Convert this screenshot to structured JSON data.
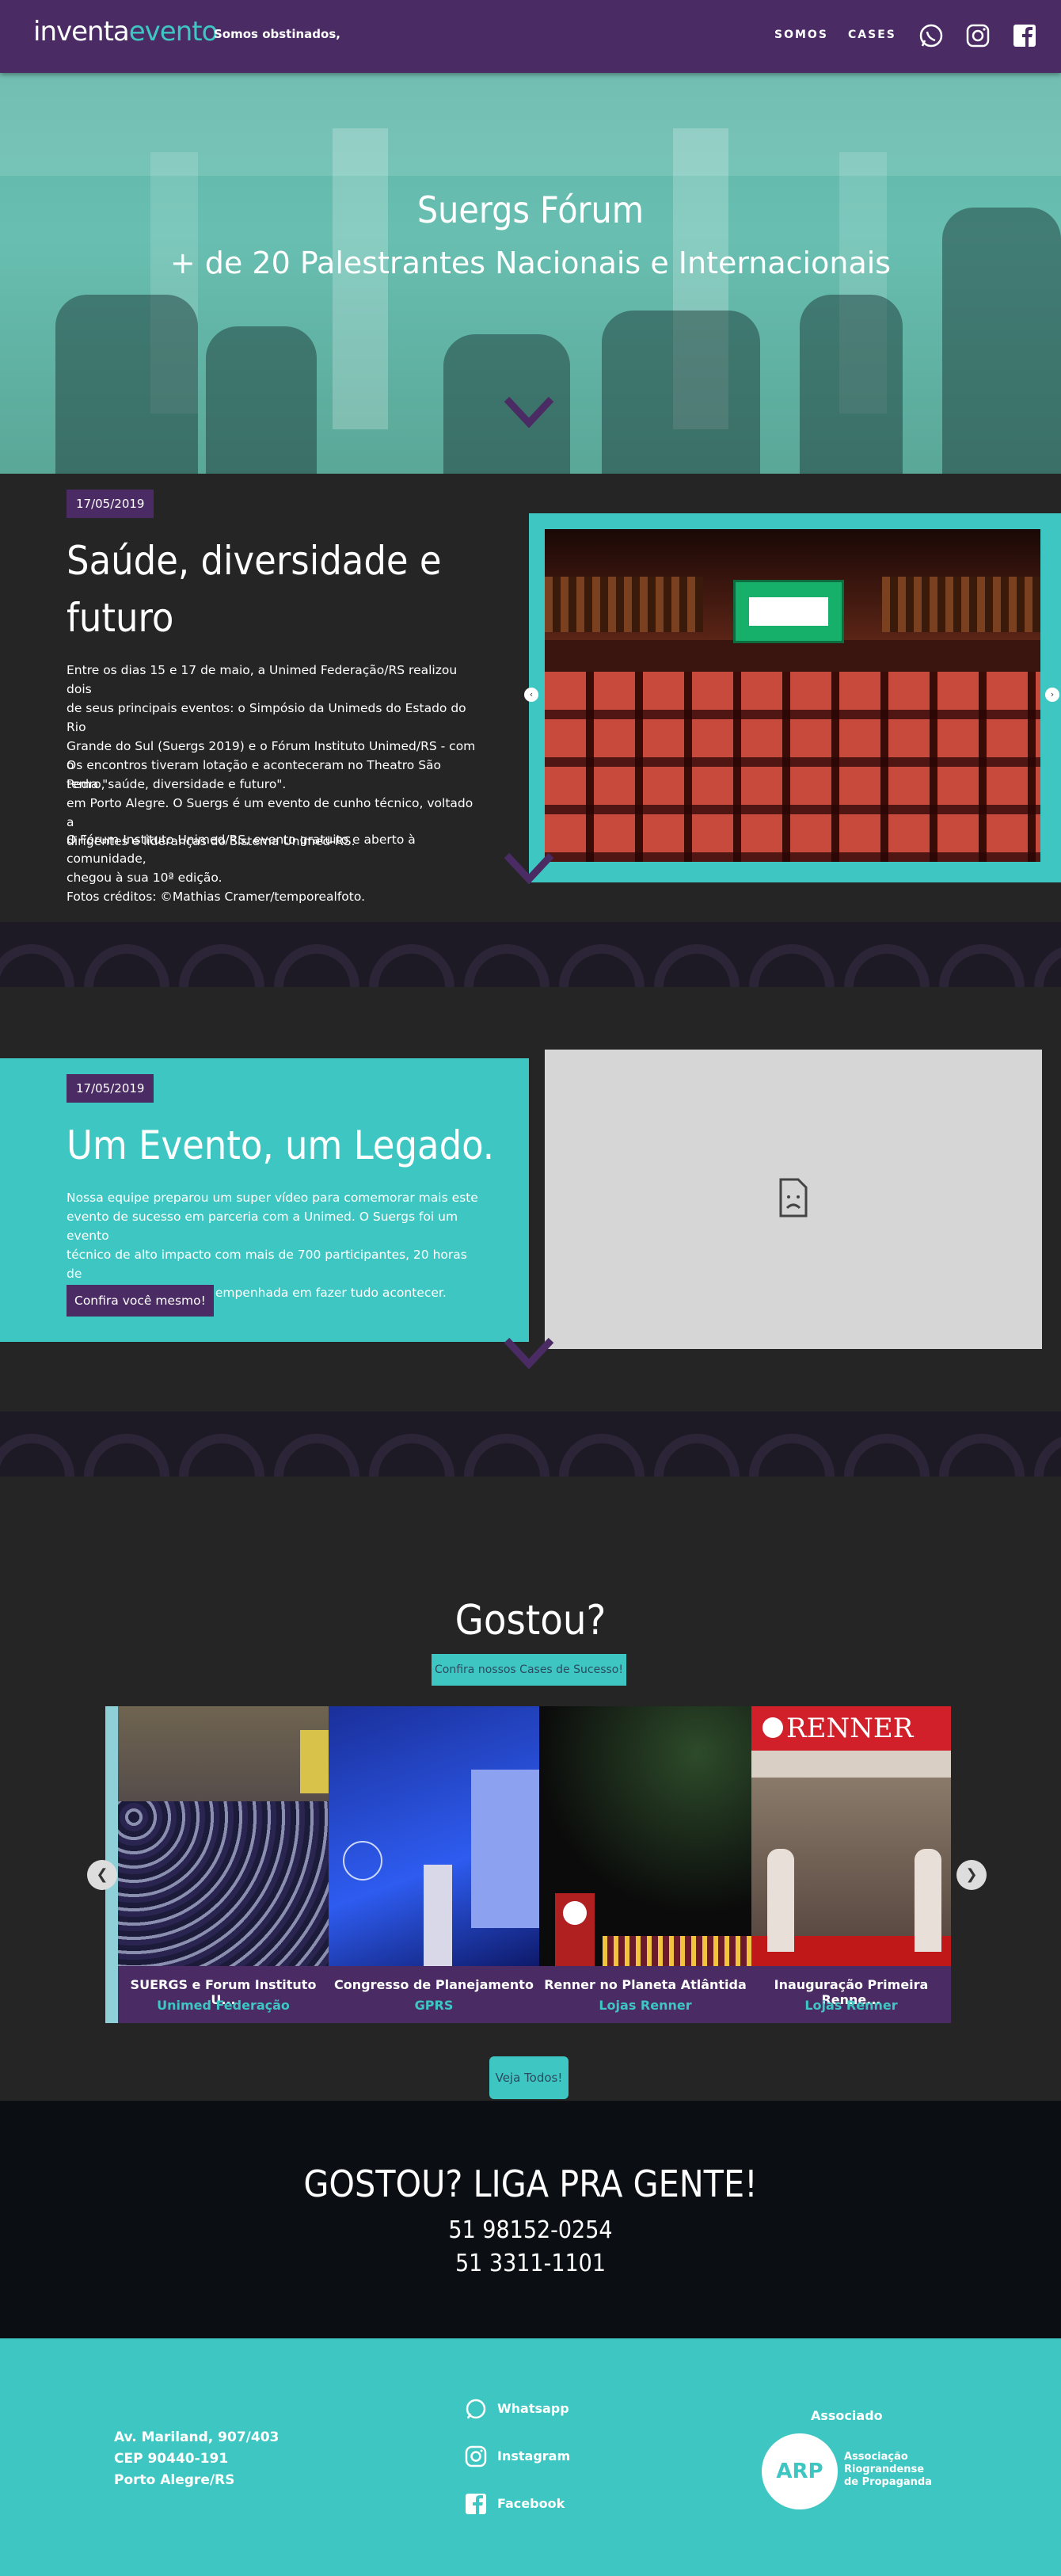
{
  "header": {
    "logo_part1": "inventa",
    "logo_part2": "evento",
    "tagline": "Somos obstinados,",
    "nav": [
      "SOMOS",
      "CASES"
    ],
    "icons": [
      "whatsapp-icon",
      "instagram-icon",
      "facebook-icon"
    ]
  },
  "hero": {
    "title": "Suergs Fórum",
    "subtitle": "+ de 20 Palestrantes Nacionais e Internacionais"
  },
  "section1": {
    "date": "17/05/2019",
    "title_line1": "Saúde, diversidade e",
    "title_line2": "futuro",
    "p1": [
      "Entre os dias 15 e 17 de maio, a Unimed Federação/RS realizou dois",
      "de seus principais eventos: o Simpósio da Unimeds do Estado do Rio",
      "Grande do Sul (Suergs 2019) e o Fórum Instituto Unimed/RS - com o",
      "tema \"saúde, diversidade e futuro\"."
    ],
    "p2": [
      "Os encontros tiveram lotação e aconteceram no Theatro São Pedro,",
      "em Porto Alegre. O Suergs é um evento de cunho técnico, voltado a",
      "dirigentes e lideranças do Sistema Unimed-RS."
    ],
    "p3": [
      "O Fórum Instituto Unimed/RS, evento gratuito e aberto à comunidade,",
      "chegou à sua 10ª edição."
    ],
    "p4": "Fotos créditos: ©Mathias Cramer/temporealfoto."
  },
  "section2": {
    "date": "17/05/2019",
    "title": "Um Evento, um Legado.",
    "p": [
      "Nossa equipe preparou um super vídeo para comemorar mais este",
      "evento de sucesso em parceria com a Unimed. O Suergs foi um evento",
      "técnico de alto impacto com mais de 700 participantes, 20 horas de",
      "palestras e uma equipe empenhada em fazer tudo acontecer."
    ],
    "button": "Confira você mesmo!"
  },
  "cases": {
    "title": "Gostou?",
    "subtitle": "Confira nossos Cases de Sucesso!",
    "items": [
      {
        "title": "SUERGS e Forum Instituto U...",
        "client": "Unimed Federação"
      },
      {
        "title": "Congresso de Planejamento",
        "client": "GPRS"
      },
      {
        "title": "Renner no Planeta Atlântida",
        "client": "Lojas Renner"
      },
      {
        "title": "Inauguração Primeira Renne...",
        "client": "Lojas Renner"
      }
    ],
    "button": "Veja Todos!",
    "prev": "❮",
    "next": "❯"
  },
  "contact": {
    "title": "GOSTOU? LIGA PRA GENTE!",
    "phone1": "51 98152-0254",
    "phone2": "51 3311-1101"
  },
  "footer": {
    "address": [
      "Av. Mariland, 907/403",
      "CEP 90440-191",
      "Porto Alegre/RS"
    ],
    "links": [
      "Whatsapp",
      "Instagram",
      "Facebook"
    ],
    "associado": "Associado",
    "arp_badge": "ARP",
    "arp_name": [
      "Associação",
      "Riograndense",
      "de Propaganda"
    ]
  },
  "colors": {
    "purple": "#4b2b63",
    "teal": "#3ec7c2",
    "dark": "#252525",
    "navy": "#0b0f14"
  }
}
